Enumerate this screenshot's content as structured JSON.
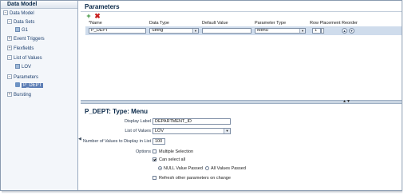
{
  "tree": {
    "title": "Data Model",
    "nodes": [
      {
        "label": "Data Model",
        "toggle": "−"
      },
      {
        "label": "Data Sets",
        "toggle": "−"
      },
      {
        "label": "G1",
        "toggle": ""
      },
      {
        "label": "Event Triggers",
        "toggle": "+"
      },
      {
        "label": "Flexfields",
        "toggle": "+"
      },
      {
        "label": "List of Values",
        "toggle": "−"
      },
      {
        "label": "LOV",
        "toggle": ""
      },
      {
        "label": "Parameters",
        "toggle": "−"
      },
      {
        "label": "P_DEPT",
        "toggle": ""
      },
      {
        "label": "Bursting",
        "toggle": "+"
      }
    ]
  },
  "parameters": {
    "title": "Parameters",
    "add_icon": "+",
    "delete_icon": "✖",
    "columns": {
      "name": "*Name",
      "data_type": "Data Type",
      "default_value": "Default Value",
      "parameter_type": "Parameter Type",
      "row_placement": "Row Placement",
      "reorder": "Reorder"
    },
    "row": {
      "name": "P_DEPT",
      "data_type": "String",
      "default_value": "",
      "parameter_type": "Menu",
      "row_placement": "1"
    }
  },
  "detail": {
    "title": "P_DEPT: Type: Menu",
    "display_label_label": "Display Label",
    "display_label_value": "DEPARTMENT_ID",
    "lov_label": "List of Values",
    "lov_value": "LOV",
    "num_values_label": "Number of Values to Display in List",
    "num_values_value": "100",
    "options_label": "Options",
    "multiple_selection": "Multiple Selection",
    "can_select_all": "Can select all",
    "null_value_passed": "NULL Value Passed",
    "all_values_passed": "All Values Passed",
    "refresh_other": "Refresh other parameters on change"
  },
  "icons": {
    "dropdown": "▼",
    "up": "▲",
    "down": "▼",
    "collapse_arrow": "◀",
    "splitter_grip": "▲▼"
  },
  "colors": {
    "selected_row": "#cfdcec",
    "selected_node": "#5e7fb6",
    "title_text": "#0b2a4a"
  }
}
